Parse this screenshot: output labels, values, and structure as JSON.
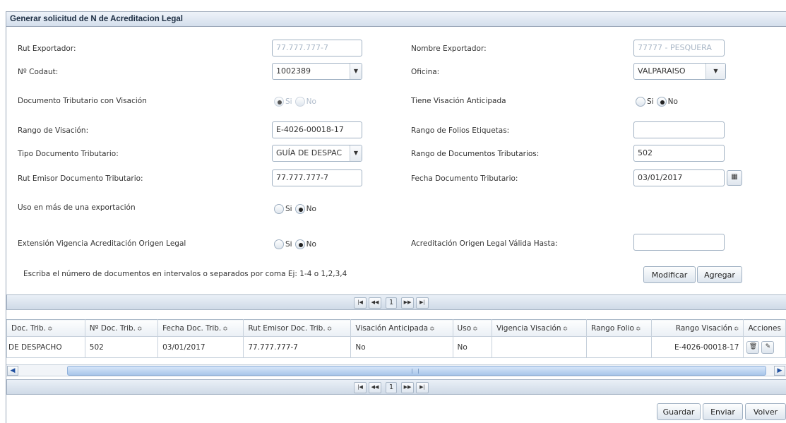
{
  "panel": {
    "title": "Generar solicitud de N de Acreditacion Legal"
  },
  "form": {
    "rut_exportador": {
      "label": "Rut Exportador:",
      "value": "77.777.777-7"
    },
    "nombre_exportador": {
      "label": "Nombre Exportador:",
      "value": "77777 - PESQUERA"
    },
    "codaut": {
      "label": "Nº Codaut:",
      "value": "1002389"
    },
    "oficina": {
      "label": "Oficina:",
      "value": "VALPARAISO"
    },
    "doc_trib_visacion": {
      "label": "Documento Tributario con Visación",
      "si": "Si",
      "no": "No",
      "selected": "Si"
    },
    "visacion_anticipada": {
      "label": "Tiene Visación Anticipada",
      "si": "Si",
      "no": "No",
      "selected": "No"
    },
    "rango_visacion": {
      "label": "Rango de Visación:",
      "value": "E-4026-00018-17"
    },
    "rango_folios": {
      "label": "Rango de Folios Etiquetas:",
      "value": ""
    },
    "tipo_doc": {
      "label": "Tipo Documento Tributario:",
      "value": "GUÍA DE DESPAC"
    },
    "rango_docs": {
      "label": "Rango de Documentos Tributarios:",
      "value": "502"
    },
    "rut_emisor": {
      "label": "Rut Emisor Documento Tributario:",
      "value": "77.777.777-7"
    },
    "fecha_doc": {
      "label": "Fecha Documento Tributario:",
      "value": "03/01/2017"
    },
    "uso_mas_exportacion": {
      "label": "Uso en más de una exportación",
      "si": "Si",
      "no": "No",
      "selected": "No"
    },
    "extension_vigencia": {
      "label": "Extensión Vigencia Acreditación Origen Legal",
      "si": "Si",
      "no": "No",
      "selected": "No"
    },
    "acreditacion_valida": {
      "label": "Acreditación Origen Legal Válida Hasta:",
      "value": ""
    },
    "hint": "Escriba el número de documentos en intervalos o separados por coma Ej: 1-4 o 1,2,3,4",
    "modificar_label": "Modificar",
    "agregar_label": "Agregar"
  },
  "pager": {
    "first": "|◀",
    "prev": "◀◀",
    "page": "1",
    "next": "▶▶",
    "last": "▶|"
  },
  "table": {
    "sort_glyph": "≎",
    "columns": [
      "Doc. Trib.",
      "Nº Doc. Trib.",
      "Fecha Doc. Trib.",
      "Rut Emisor Doc. Trib.",
      "Visación Anticipada",
      "Uso",
      "Vigencia Visación",
      "Rango Folio",
      "Rango Visación",
      "Acciones"
    ],
    "rows": [
      {
        "doc_trib": "DE DESPACHO",
        "num_doc": "502",
        "fecha": "03/01/2017",
        "rut_emisor": "77.777.777-7",
        "visacion_anticipada": "No",
        "uso": "No",
        "vigencia": "",
        "rango_folio": "",
        "rango_visacion": "E-4026-00018-17"
      }
    ]
  },
  "footer": {
    "guardar_label": "Guardar",
    "enviar_label": "Enviar",
    "volver_label": "Volver"
  }
}
